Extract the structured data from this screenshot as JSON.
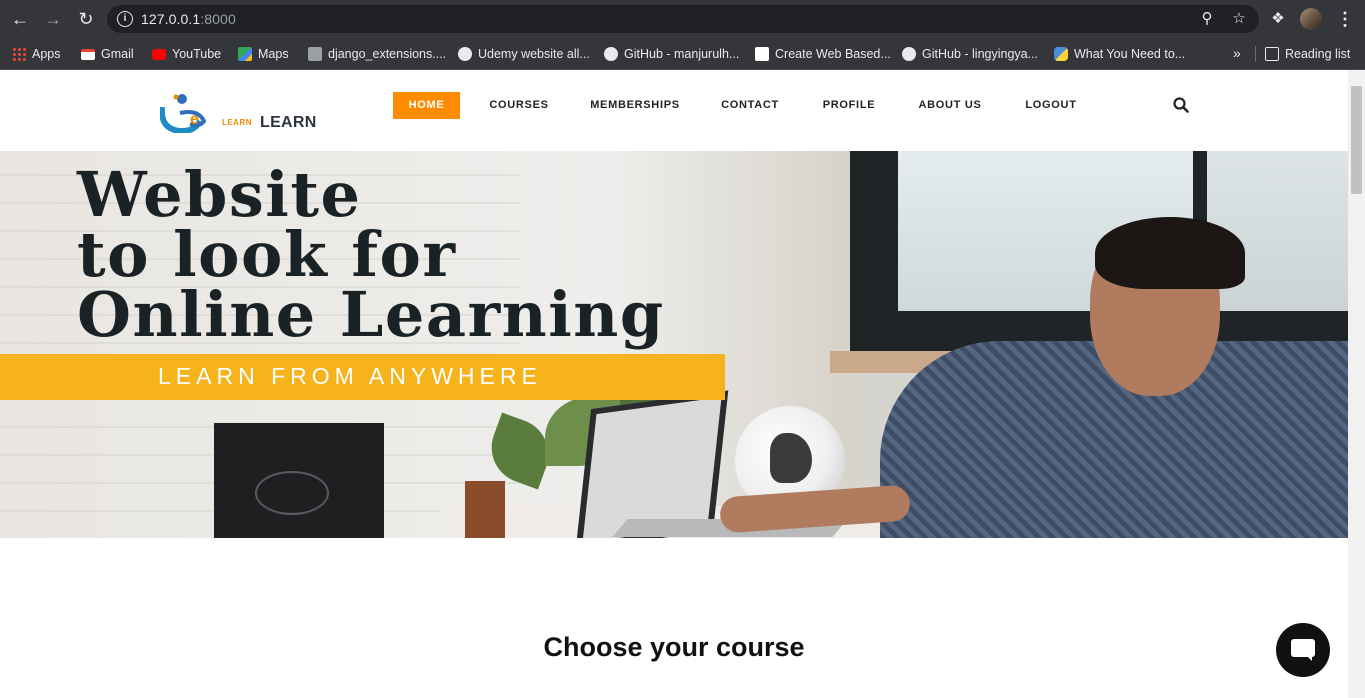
{
  "browser": {
    "url_host": "127.0.0.1",
    "url_port": ":8000",
    "icons": {
      "back": "arrow-left-icon",
      "forward": "arrow-right-icon",
      "reload": "reload-icon",
      "info": "info-icon",
      "zoom": "zoom-icon",
      "bookmark": "star-icon",
      "extensions": "puzzle-icon",
      "menu": "kebab-menu-icon"
    }
  },
  "bookmarks": {
    "items": [
      {
        "label": "Apps",
        "color": "#ea4335"
      },
      {
        "label": "Gmail",
        "color": "#ea4335"
      },
      {
        "label": "YouTube",
        "color": "#ff0000"
      },
      {
        "label": "Maps",
        "color": "#34a853"
      },
      {
        "label": "django_extensions....",
        "color": "#9aa0a6"
      },
      {
        "label": "Udemy website all...",
        "color": "#e8eaed"
      },
      {
        "label": "GitHub - manjurulh...",
        "color": "#e8eaed"
      },
      {
        "label": "Create Web Based...",
        "color": "#ffffff"
      },
      {
        "label": "GitHub - lingyingya...",
        "color": "#e8eaed"
      },
      {
        "label": "What You Need to...",
        "color": "#4a8fd8"
      }
    ],
    "more": "»",
    "reading_list": "Reading list"
  },
  "site": {
    "logo_small": "LEARN",
    "logo_text": "LEARN",
    "nav": [
      {
        "label": "HOME",
        "active": true
      },
      {
        "label": "COURSES",
        "active": false
      },
      {
        "label": "MEMBERSHIPS",
        "active": false
      },
      {
        "label": "CONTACT",
        "active": false
      },
      {
        "label": "PROFILE",
        "active": false
      },
      {
        "label": "ABOUT US",
        "active": false
      },
      {
        "label": "LOGOUT",
        "active": false
      }
    ],
    "accent_color": "#ff8c00"
  },
  "hero": {
    "title_lines": [
      "Website",
      "to look for",
      "Online Learning"
    ],
    "band_text": "LEARN FROM ANYWHERE",
    "band_color": "#f7b31b"
  },
  "section": {
    "title": "Choose your course"
  }
}
